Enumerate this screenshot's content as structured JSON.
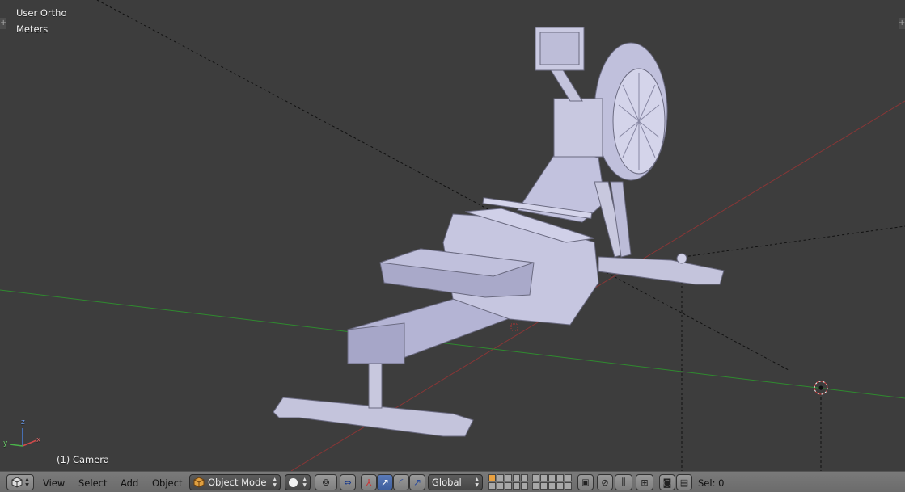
{
  "viewport": {
    "view_label": "User Ortho",
    "units_label": "Meters",
    "object_label": "(1) Camera",
    "axis_labels": {
      "x": "x",
      "y": "y",
      "z": "z"
    },
    "colors": {
      "background": "#3d3d3d",
      "x_axis": "#a33a3a",
      "y_axis": "#3a9a3a",
      "model": "#b9b9d8"
    }
  },
  "header": {
    "editor_type_icon": "cube-3d-view-icon",
    "menus": [
      "View",
      "Select",
      "Add",
      "Object"
    ],
    "mode": "Object Mode",
    "shading_icon": "solid-sphere-icon",
    "pivot_icon": "pivot-point-icon",
    "orientation": "Global",
    "selection_info": "Sel: 0"
  }
}
